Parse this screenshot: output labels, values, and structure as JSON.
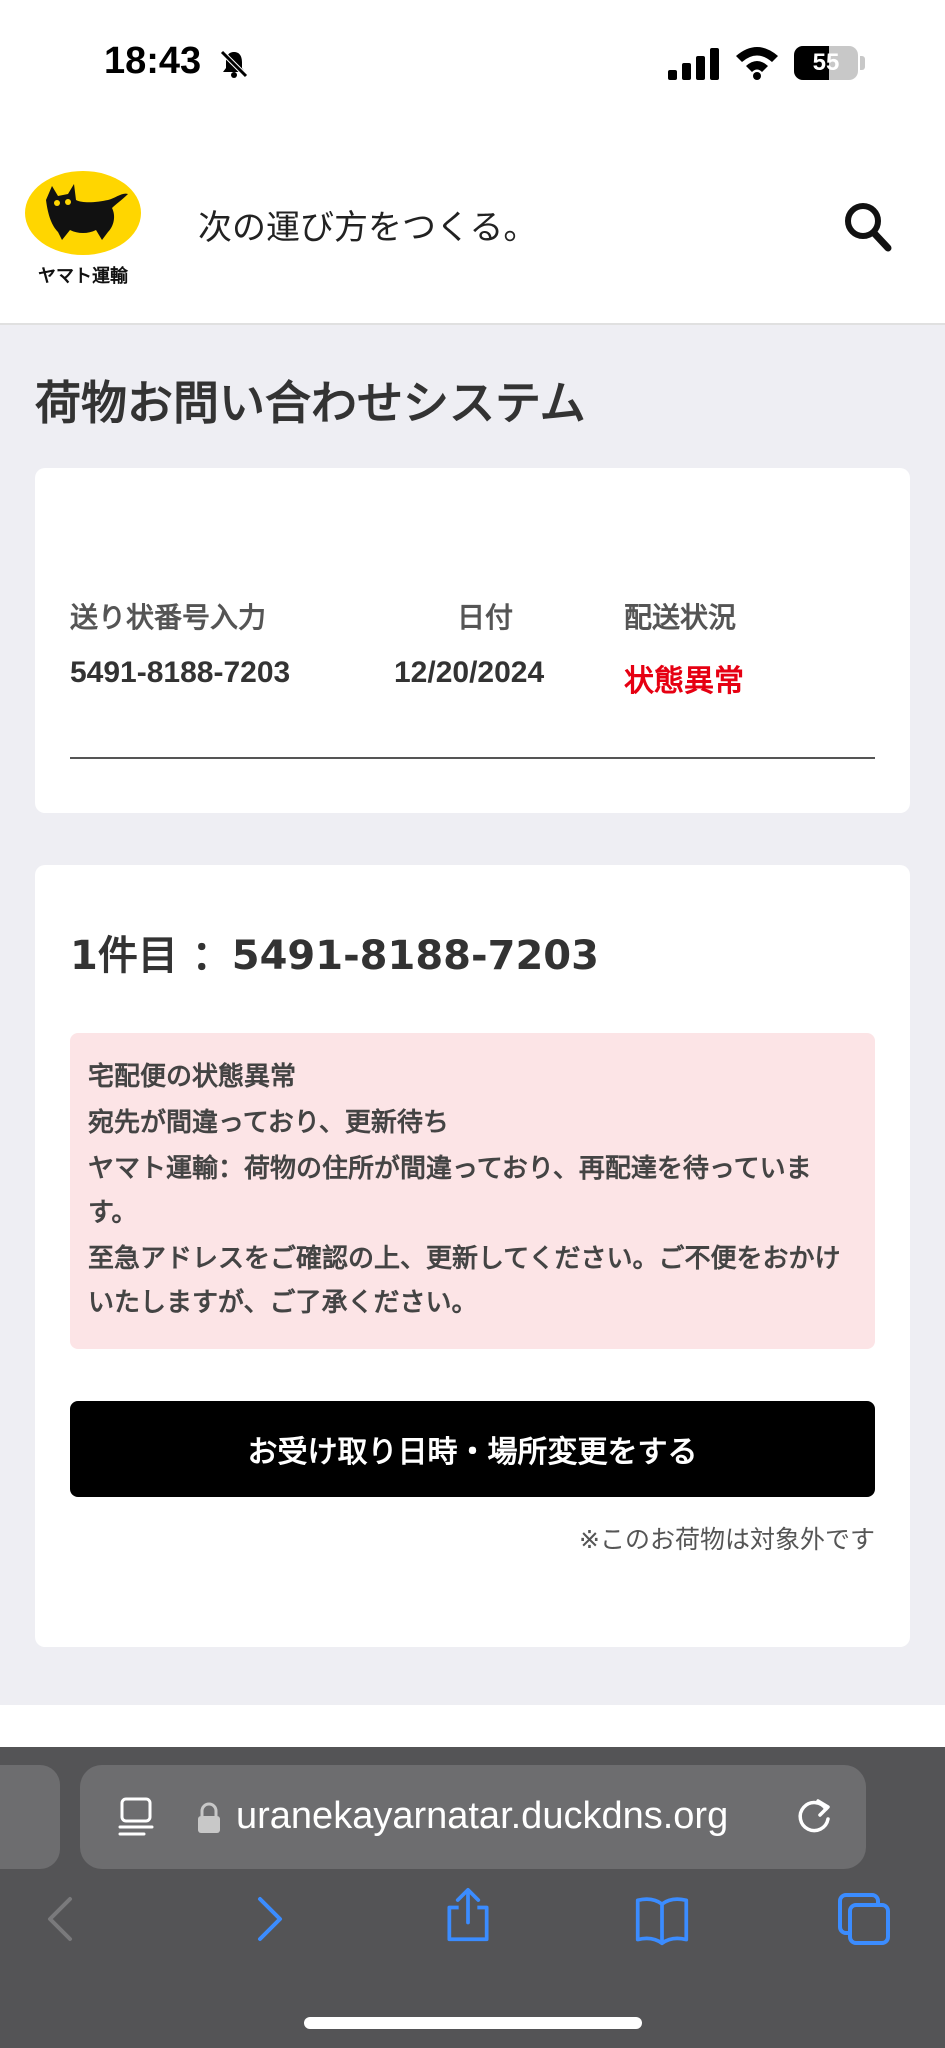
{
  "status_bar": {
    "time": "18:43",
    "battery_level": "55",
    "battery_percent": 55,
    "icons": [
      "bell-muted-icon",
      "signal-icon",
      "wifi-icon",
      "battery-icon"
    ]
  },
  "header": {
    "logo_text": "ヤマト運輸",
    "tagline": "次の運び方をつくる。",
    "logo_color": "#ffd600",
    "icons": [
      "cat-logo-icon",
      "search-icon"
    ]
  },
  "page": {
    "title": "荷物お問い合わせシステム"
  },
  "summary": {
    "columns": [
      "送り状番号入力",
      "日付",
      "配送状況"
    ],
    "row": {
      "tracking_number": "5491-8188-7203",
      "date": "12/20/2024",
      "status": "状態異常"
    },
    "status_color": "#e60012"
  },
  "detail": {
    "heading": "1件目 ：5491-8188-7203",
    "alert": {
      "title": "宅配便の状態異常",
      "status": "宛先が間違っており、更新待ち",
      "body1": "ヤマト運輸：荷物の住所が間違っており、再配達を待っています。",
      "body2": "至急アドレスをご確認の上、更新してください。ご不便をおかけいたしますが、ご了承ください。"
    },
    "alert_bg": "#fce4e6",
    "button_label": "お受け取り日時・場所変更をする",
    "note": "※このお荷物は対象外です"
  },
  "browser": {
    "url": "uranekayarnatar.duckdns.org",
    "icons": [
      "tab-overview-icon",
      "lock-icon",
      "reload-icon",
      "back-icon",
      "forward-icon",
      "share-icon",
      "bookmarks-icon",
      "tabs-icon"
    ]
  }
}
